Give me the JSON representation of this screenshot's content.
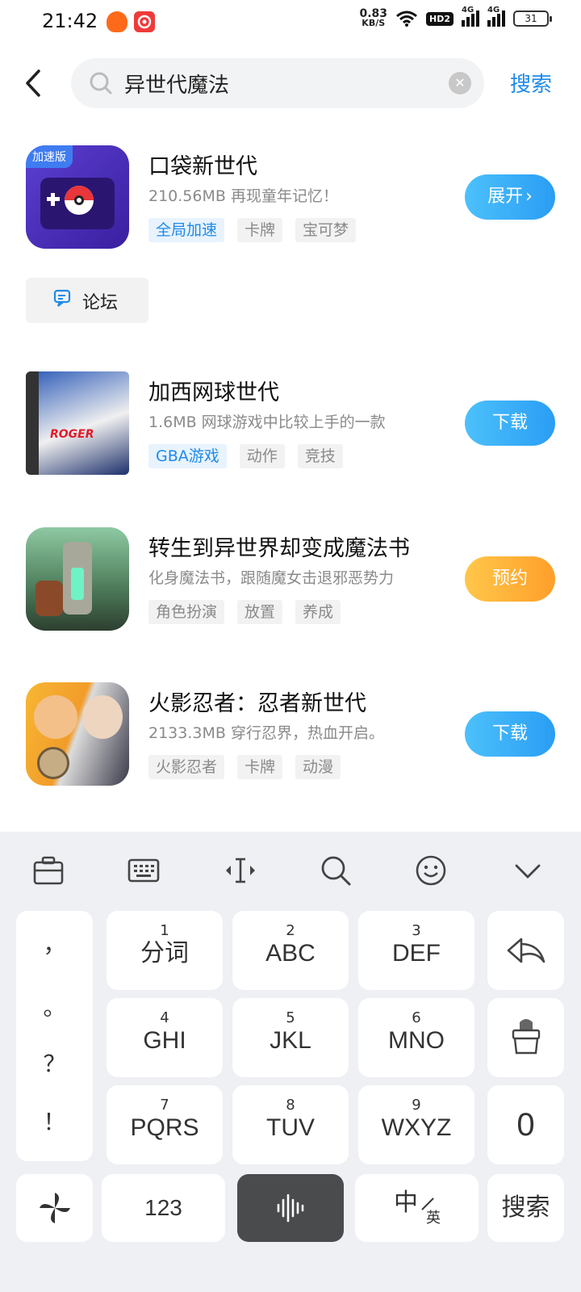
{
  "status_bar": {
    "time": "21:42",
    "net_speed_value": "0.83",
    "net_speed_unit": "KB/S",
    "hd_badge": "HD2",
    "signal1": "4G",
    "signal2": "4G",
    "battery": "31"
  },
  "header": {
    "query": "异世代魔法",
    "search_label": "搜索"
  },
  "results": [
    {
      "title": "口袋新世代",
      "desc": "210.56MB  再现童年记忆！",
      "badge": "加速版",
      "tags": [
        "全局加速",
        "卡牌",
        "宝可梦"
      ],
      "action": "展开",
      "action_chevron": "›"
    },
    {
      "title": "加西网球世代",
      "desc": "1.6MB  网球游戏中比较上手的一款",
      "tags": [
        "GBA游戏",
        "动作",
        "竞技"
      ],
      "action": "下载"
    },
    {
      "title": "转生到异世界却变成魔法书",
      "desc": "化身魔法书，跟随魔女击退邪恶势力",
      "tags": [
        "角色扮演",
        "放置",
        "养成"
      ],
      "action": "预约"
    },
    {
      "title": "火影忍者：忍者新世代",
      "desc": "2133.3MB  穿行忍界，热血开启。",
      "tags": [
        "火影忍者",
        "卡牌",
        "动漫"
      ],
      "action": "下载"
    }
  ],
  "forum_label": "论坛",
  "keyboard": {
    "punct": [
      "，",
      "。",
      "？",
      "！"
    ],
    "keys": [
      {
        "num": "1",
        "label": "分词"
      },
      {
        "num": "2",
        "label": "ABC"
      },
      {
        "num": "3",
        "label": "DEF"
      },
      {
        "num": "4",
        "label": "GHI"
      },
      {
        "num": "5",
        "label": "JKL"
      },
      {
        "num": "6",
        "label": "MNO"
      },
      {
        "num": "7",
        "label": "PQRS"
      },
      {
        "num": "8",
        "label": "TUV"
      },
      {
        "num": "9",
        "label": "WXYZ"
      }
    ],
    "zero": "0",
    "num_switch": "123",
    "lang_zh": "中",
    "lang_en": "英",
    "search_key": "搜索"
  },
  "colors": {
    "accent": "#1f8ae8",
    "button_blue": "#2a9df4",
    "button_orange": "#ff9f2a"
  }
}
